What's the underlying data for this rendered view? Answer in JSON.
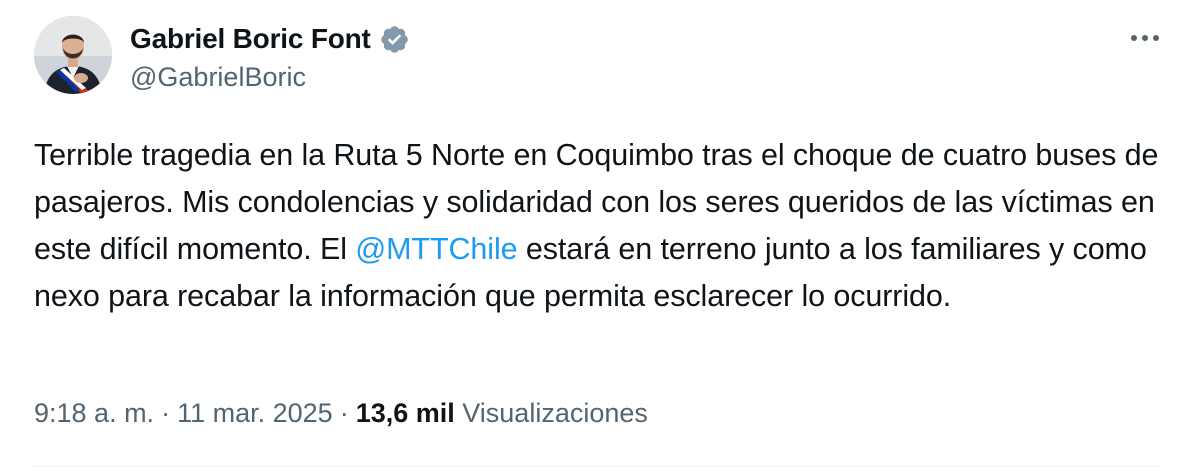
{
  "author": {
    "name": "Gabriel Boric Font",
    "handle": "@GabrielBoric",
    "verified_icon": "verified-badge-icon"
  },
  "tweet": {
    "text_before": "Terrible tragedia en la Ruta 5 Norte en Coquimbo tras el choque de cuatro buses de pasajeros. Mis condolencias y solidaridad con los seres queridos de las víctimas en este difícil momento. El ",
    "mention": "@MTTChile",
    "text_after": " estará en terreno junto a los familiares y como nexo para recabar la información que permita esclarecer lo ocurrido."
  },
  "meta": {
    "time": "9:18 a. m.",
    "sep1": "·",
    "date": "11 mar. 2025",
    "sep2": "·",
    "views_count": "13,6 mil",
    "views_label": "Visualizaciones"
  },
  "colors": {
    "text": "#0f1419",
    "secondary": "#536471",
    "link": "#1d9bf0",
    "verified": "#829aab"
  }
}
